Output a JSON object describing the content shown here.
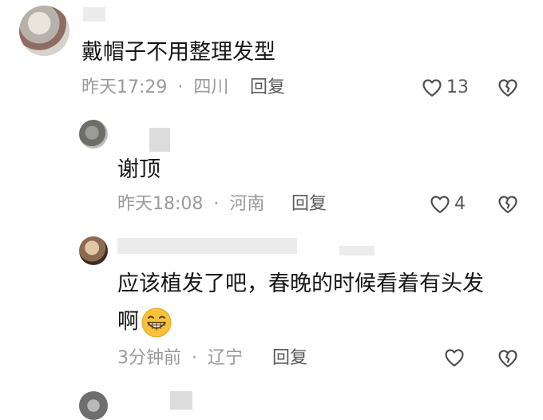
{
  "comments": [
    {
      "text": "戴帽子不用整理发型",
      "time": "昨天17:29",
      "location": "四川",
      "reply_label": "回复",
      "likes": "13"
    },
    {
      "text": "谢顶",
      "time": "昨天18:08",
      "location": "河南",
      "reply_label": "回复",
      "likes": "4"
    },
    {
      "text_line1": "应该植发了吧，春晚的时候看着有头发",
      "text_line2": "啊",
      "time": "3分钟前",
      "location": "辽宁",
      "reply_label": "回复",
      "likes": ""
    }
  ],
  "separator": "·",
  "icons": {
    "like": "heart-outline-icon",
    "dislike": "broken-heart-icon",
    "emoji": "grinning-face-emoji"
  },
  "colors": {
    "text": "#161616",
    "meta": "#9a9a9a",
    "action": "#5a5a5a",
    "emoji_face": "#f7c23a"
  }
}
